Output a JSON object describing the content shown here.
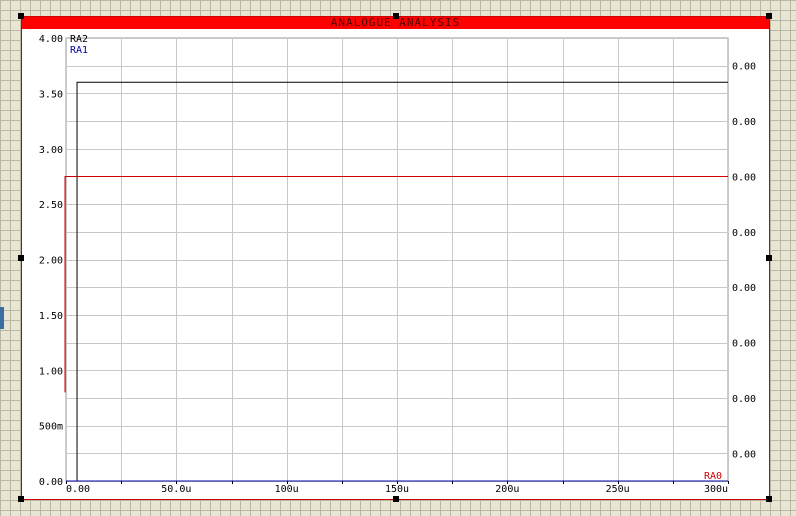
{
  "window": {
    "title": "ANALOGUE ANALYSIS"
  },
  "colors": {
    "title_bar": "#ff0000",
    "frame_border": "#cc0000",
    "grid": "#c8c8c8",
    "background_grid": "#b8b6a4"
  },
  "chart_data": {
    "type": "line",
    "title": "ANALOGUE ANALYSIS",
    "xlim": [
      0,
      300
    ],
    "ylim": [
      0,
      4
    ],
    "x_unit": "u",
    "x_ticks": [
      0,
      50,
      100,
      150,
      200,
      250,
      300
    ],
    "x_tick_labels": [
      "0.00",
      "50.0u",
      "100u",
      "150u",
      "200u",
      "250u",
      "300u"
    ],
    "y_ticks": [
      0,
      0.5,
      1,
      1.5,
      2,
      2.5,
      3,
      3.5,
      4
    ],
    "y_tick_labels": [
      "0.00",
      "500m",
      "1.00",
      "1.50",
      "2.00",
      "2.50",
      "3.00",
      "3.50",
      "4.00"
    ],
    "right_axis_labels": [
      "0.00",
      "0.00",
      "0.00",
      "0.00",
      "0.00",
      "0.00",
      "0.00",
      "0.00"
    ],
    "grid": true,
    "series": [
      {
        "name": "RA2",
        "color": "#000000",
        "axis": "left",
        "x": [
          0,
          5,
          5,
          300
        ],
        "y": [
          0,
          0,
          3.6,
          3.6
        ]
      },
      {
        "name": "RA1",
        "color": "#0000aa",
        "axis": "left",
        "x": [
          0,
          300
        ],
        "y": [
          0,
          0
        ]
      },
      {
        "name": "RA0",
        "color": "#cc0000",
        "axis": "left",
        "x": [
          -6,
          -6,
          300
        ],
        "y": [
          0.8,
          2.75,
          2.75
        ]
      }
    ]
  }
}
